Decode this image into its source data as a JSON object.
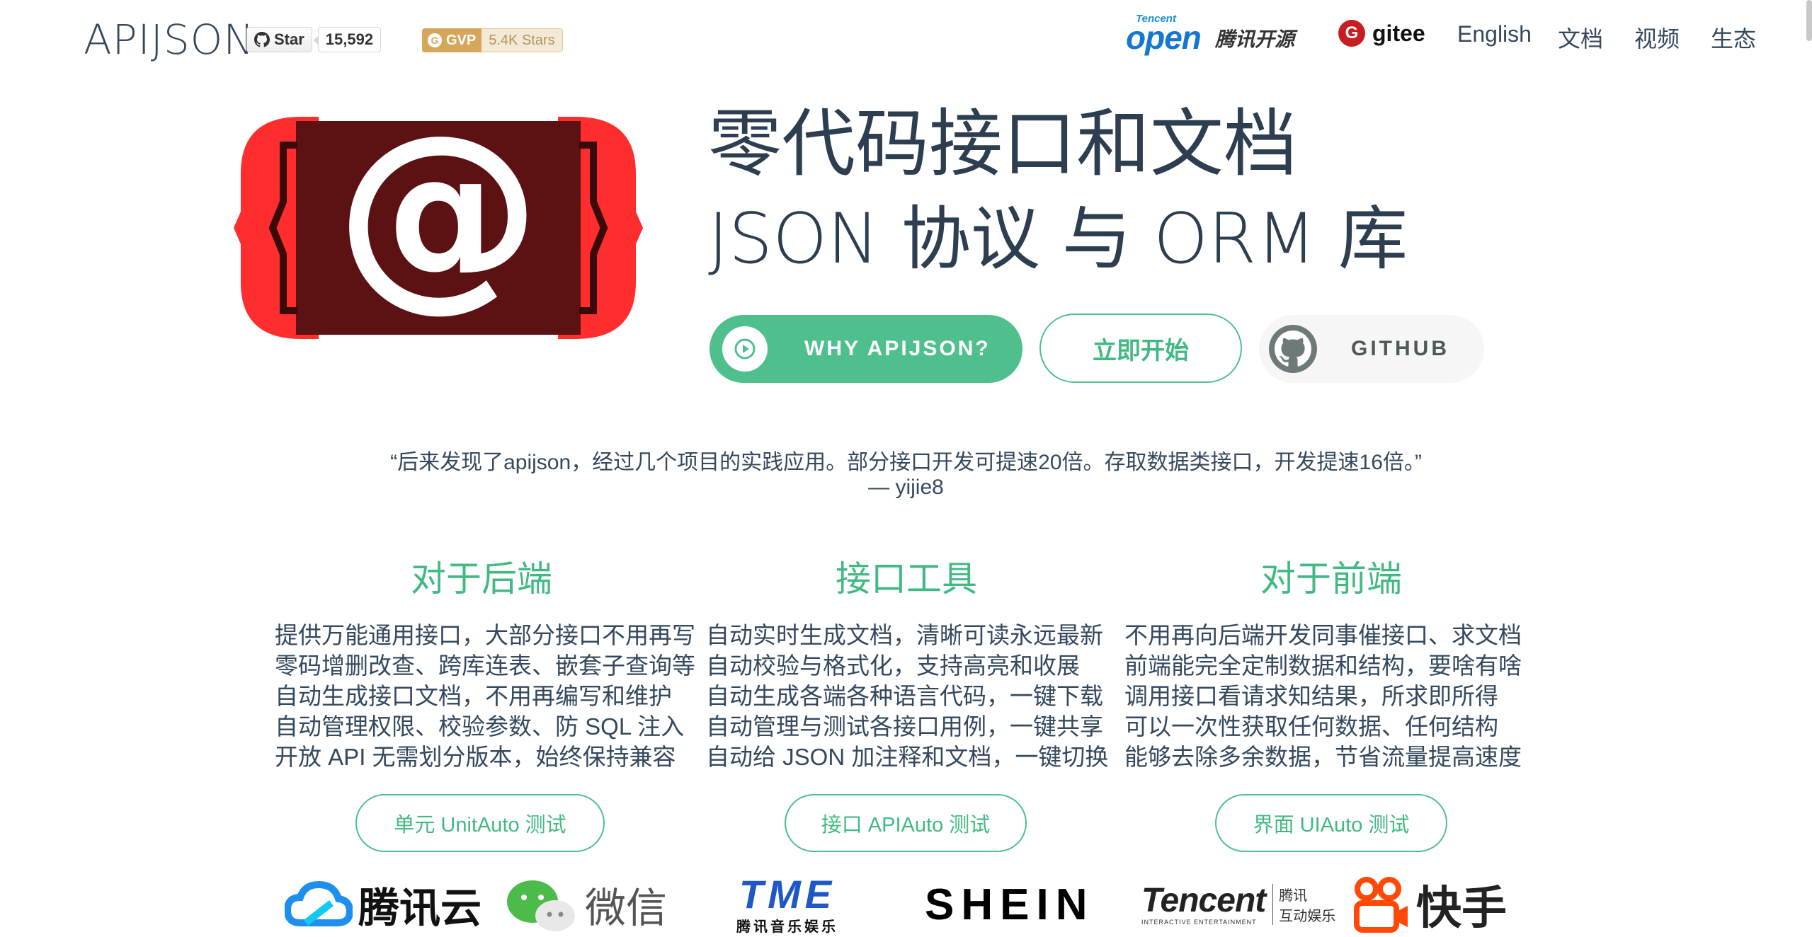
{
  "header": {
    "brand": "APIJSON",
    "github_badge": {
      "label": "Star",
      "count": "15,592"
    },
    "gvp_badge": {
      "label": "GVP",
      "count": "5.4K Stars"
    },
    "tencent_open": {
      "small": "Tencent",
      "logo": "open",
      "cn": "腾讯开源"
    },
    "gitee": "gitee",
    "nav": [
      "English",
      "文档",
      "视频",
      "生态"
    ]
  },
  "hero": {
    "title_line1": "零代码接口和文档",
    "title_line2": "JSON 协议 与 ORM 库",
    "buttons": {
      "why": "WHY APIJSON?",
      "start": "立即开始",
      "github": "GITHUB"
    }
  },
  "quote": {
    "text": "“后来发现了apijson，经过几个项目的实践应用。部分接口开发可提速20倍。存取数据类接口，开发提速16倍。”",
    "author": "— yijie8"
  },
  "features": [
    {
      "title": "对于后端",
      "lines": [
        "提供万能通用接口，大部分接口不用再写",
        "零码增删改查、跨库连表、嵌套子查询等",
        "自动生成接口文档，不用再编写和维护",
        "自动管理权限、校验参数、防 SQL 注入",
        "开放 API 无需划分版本，始终保持兼容"
      ],
      "button": "单元 UnitAuto 测试"
    },
    {
      "title": "接口工具",
      "lines": [
        "自动实时生成文档，清晰可读永远最新",
        "自动校验与格式化，支持高亮和收展",
        "自动生成各端各种语言代码，一键下载",
        "自动管理与测试各接口用例，一键共享",
        "自动给 JSON 加注释和文档，一键切换"
      ],
      "button": "接口 APIAuto 测试"
    },
    {
      "title": "对于前端",
      "lines": [
        "不用再向后端开发同事催接口、求文档",
        "前端能完全定制数据和结构，要啥有啥",
        "调用接口看请求知结果，所求即所得",
        "可以一次性获取任何数据、任何结构",
        "能够去除多余数据，节省流量提高速度"
      ],
      "button": "界面 UIAuto 测试"
    }
  ],
  "partners": {
    "tencent_cloud": "腾讯云",
    "wechat": "微信",
    "tme": {
      "mark": "TME",
      "cn": "腾讯音乐娱乐"
    },
    "shein": "SHEIN",
    "tencent_ent": {
      "en": "Tencent",
      "sub": "INTERACTIVE ENTERTAINMENT",
      "cn1": "腾讯",
      "cn2": "互动娱乐"
    },
    "kuaishou": "快手"
  },
  "colors": {
    "accent": "#42b983",
    "button_green": "#4fc08d",
    "text": "#2c3e50",
    "logo_red": "#ff2d2d",
    "logo_dark": "#5c1212"
  }
}
